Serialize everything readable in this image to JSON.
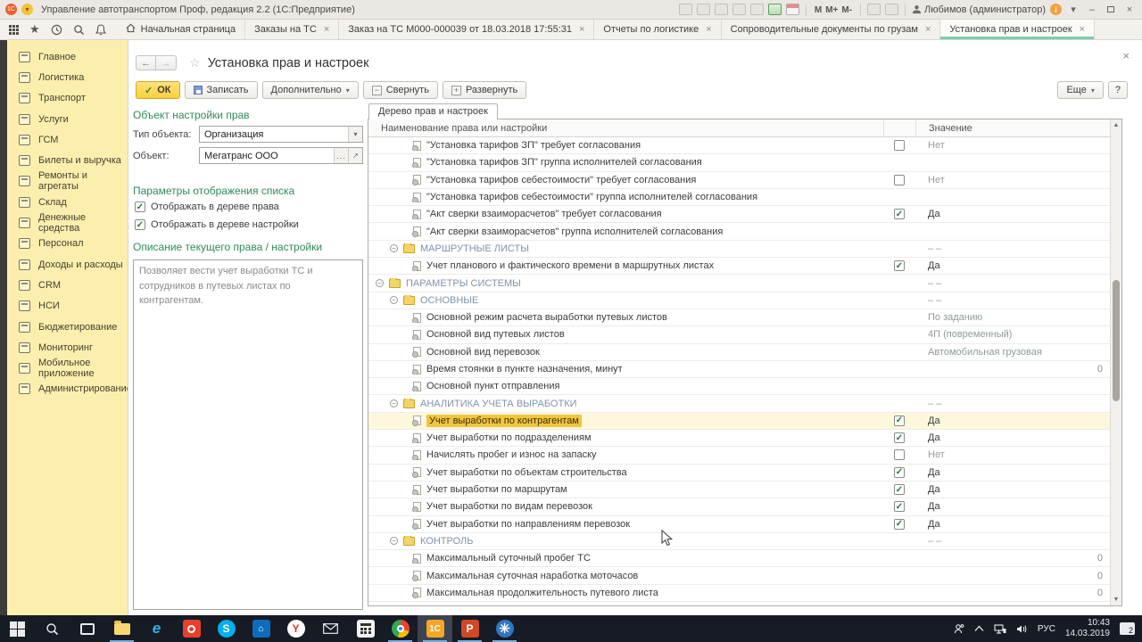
{
  "titlebar": {
    "title": "Управление автотранспортом Проф, редакция 2.2 (1С:Предприятие)",
    "user": "Любимов (администратор)",
    "memory_buttons": [
      "M",
      "M+",
      "M-"
    ],
    "info_glyph": "i",
    "minimize": "–",
    "close": "×"
  },
  "tabs": {
    "items": [
      {
        "label": "Начальная страница",
        "closable": false,
        "active": false,
        "icon": "home-icon"
      },
      {
        "label": "Заказы на ТС",
        "closable": true,
        "active": false
      },
      {
        "label": "Заказ на ТС М000-000039 от 18.03.2018 17:55:31",
        "closable": true,
        "active": false
      },
      {
        "label": "Отчеты по логистике",
        "closable": true,
        "active": false
      },
      {
        "label": "Сопроводительные документы по грузам",
        "closable": true,
        "active": false
      },
      {
        "label": "Установка прав и настроек",
        "closable": true,
        "active": true
      }
    ],
    "close_glyph": "×"
  },
  "sidebar": {
    "items": [
      {
        "label": "Главное",
        "icon": "main-icon"
      },
      {
        "label": "Логистика",
        "icon": "logistics-icon"
      },
      {
        "label": "Транспорт",
        "icon": "transport-icon"
      },
      {
        "label": "Услуги",
        "icon": "services-icon"
      },
      {
        "label": "ГСМ",
        "icon": "fuel-icon"
      },
      {
        "label": "Билеты и выручка",
        "icon": "tickets-icon"
      },
      {
        "label": "Ремонты и агрегаты",
        "icon": "repairs-icon"
      },
      {
        "label": "Склад",
        "icon": "warehouse-icon"
      },
      {
        "label": "Денежные средства",
        "icon": "money-icon"
      },
      {
        "label": "Персонал",
        "icon": "personnel-icon"
      },
      {
        "label": "Доходы и расходы",
        "icon": "income-icon"
      },
      {
        "label": "CRM",
        "icon": "crm-icon"
      },
      {
        "label": "НСИ",
        "icon": "nsi-icon"
      },
      {
        "label": "Бюджетирование",
        "icon": "budget-icon"
      },
      {
        "label": "Мониторинг",
        "icon": "monitoring-icon"
      },
      {
        "label": "Мобильное приложение",
        "icon": "mobile-icon"
      },
      {
        "label": "Администрирование",
        "icon": "admin-icon"
      }
    ]
  },
  "page": {
    "title": "Установка прав и настроек",
    "back": "←",
    "forward": "→",
    "star": "☆",
    "close": "×",
    "toolbar": {
      "ok": "ОК",
      "save": "Записать",
      "more_menu": "Дополнительно",
      "collapse": "Свернуть",
      "expand": "Развернуть",
      "more": "Еще",
      "help": "?",
      "arrow": "▾"
    },
    "form": {
      "section_object": "Объект настройки прав",
      "type_label": "Тип объекта:",
      "type_value": "Организация",
      "object_label": "Объект:",
      "object_value": "Мегатранс ООО",
      "object_dots": "...",
      "object_open": "↗",
      "section_display": "Параметры отображения списка",
      "check_rights_label": "Отображать в дереве права",
      "check_rights_checked": true,
      "check_settings_label": "Отображать в дереве настройки",
      "check_settings_checked": true,
      "section_description": "Описание текущего права / настройки",
      "description": "Позволяет вести учет выработки ТС и сотрудников в путевых листах по контрагентам."
    },
    "tree": {
      "tab": "Дерево прав и настроек",
      "col_name": "Наименование права или настройки",
      "col_value": "Значение",
      "rows": [
        {
          "type": "item",
          "label": "\"Установка тарифов ЗП\" требует согласования",
          "check": "unchecked",
          "value": "Нет",
          "selected": false
        },
        {
          "type": "item",
          "label": "\"Установка тарифов ЗП\" группа исполнителей согласования",
          "check": "none",
          "value": "",
          "selected": false
        },
        {
          "type": "item",
          "label": "\"Установка тарифов себестоимости\" требует согласования",
          "check": "unchecked",
          "value": "Нет",
          "selected": false
        },
        {
          "type": "item",
          "label": "\"Установка тарифов себестоимости\" группа исполнителей согласования",
          "check": "none",
          "value": "",
          "selected": false
        },
        {
          "type": "item",
          "label": "\"Акт сверки взаиморасчетов\" требует согласования",
          "check": "checked",
          "value": "Да",
          "selected": false
        },
        {
          "type": "item",
          "label": "\"Акт сверки взаиморасчетов\" группа исполнителей согласования",
          "check": "none",
          "value": "",
          "selected": false
        },
        {
          "type": "group",
          "level": 2,
          "label": "МАРШРУТНЫЕ ЛИСТЫ",
          "check": "none",
          "value": "–  –",
          "selected": false
        },
        {
          "type": "item",
          "label": "Учет планового и фактического времени в маршрутных листах",
          "check": "checked",
          "value": "Да",
          "selected": false
        },
        {
          "type": "group",
          "level": 1,
          "label": "ПАРАМЕТРЫ СИСТЕМЫ",
          "check": "none",
          "value": "–  –",
          "selected": false
        },
        {
          "type": "group",
          "level": 2,
          "label": "ОСНОВНЫЕ",
          "check": "none",
          "value": "–  –",
          "selected": false
        },
        {
          "type": "item",
          "label": "Основной режим расчета выработки путевых листов",
          "check": "none",
          "value": "По заданию",
          "selected": false
        },
        {
          "type": "item",
          "label": "Основной вид путевых листов",
          "check": "none",
          "value": "4П (повременный)",
          "selected": false
        },
        {
          "type": "item",
          "label": "Основной вид перевозок",
          "check": "none",
          "value": "Автомобильная грузовая",
          "selected": false
        },
        {
          "type": "item",
          "label": "Время стоянки в пункте назначения, минут",
          "check": "none",
          "value": "0",
          "align": "right",
          "selected": false
        },
        {
          "type": "item",
          "label": "Основной пункт отправления",
          "check": "none",
          "value": "",
          "selected": false
        },
        {
          "type": "group",
          "level": 2,
          "label": "АНАЛИТИКА УЧЕТА ВЫРАБОТКИ",
          "check": "none",
          "value": "–  –",
          "selected": false
        },
        {
          "type": "item",
          "label": "Учет выработки по контрагентам",
          "check": "checked",
          "value": "Да",
          "selected": true
        },
        {
          "type": "item",
          "label": "Учет выработки по подразделениям",
          "check": "checked",
          "value": "Да",
          "selected": false
        },
        {
          "type": "item",
          "label": "Начислять пробег и износ на запаску",
          "check": "unchecked",
          "value": "Нет",
          "selected": false
        },
        {
          "type": "item",
          "label": "Учет выработки по объектам строительства",
          "check": "checked",
          "value": "Да",
          "selected": false
        },
        {
          "type": "item",
          "label": "Учет выработки по маршрутам",
          "check": "checked",
          "value": "Да",
          "selected": false
        },
        {
          "type": "item",
          "label": "Учет выработки по видам перевозок",
          "check": "checked",
          "value": "Да",
          "selected": false
        },
        {
          "type": "item",
          "label": "Учет выработки по направлениям перевозок",
          "check": "checked",
          "value": "Да",
          "selected": false
        },
        {
          "type": "group",
          "level": 2,
          "label": "КОНТРОЛЬ",
          "check": "none",
          "value": "–  –",
          "selected": false
        },
        {
          "type": "item",
          "label": "Максимальный суточный пробег ТС",
          "check": "none",
          "value": "0",
          "align": "right",
          "selected": false
        },
        {
          "type": "item",
          "label": "Максимальная суточная наработка моточасов",
          "check": "none",
          "value": "0",
          "align": "right",
          "selected": false
        },
        {
          "type": "item",
          "label": "Максимальная продолжительность путевого листа",
          "check": "none",
          "value": "0",
          "align": "right",
          "selected": false
        }
      ]
    }
  },
  "taskbar": {
    "icons": [
      {
        "name": "start-button",
        "open": false,
        "active": false
      },
      {
        "name": "search-button",
        "open": false,
        "active": false
      },
      {
        "name": "task-view-button",
        "open": false,
        "active": false
      },
      {
        "name": "file-explorer-icon",
        "open": true,
        "active": false
      },
      {
        "name": "edge-icon",
        "open": false,
        "active": false
      },
      {
        "name": "red-circle-app-icon",
        "open": false,
        "active": false
      },
      {
        "name": "skype-icon",
        "open": false,
        "active": false
      },
      {
        "name": "store-icon",
        "open": false,
        "active": false
      },
      {
        "name": "yandex-browser-icon",
        "open": false,
        "active": false
      },
      {
        "name": "mail-icon",
        "open": false,
        "active": false
      },
      {
        "name": "calculator-icon",
        "open": false,
        "active": false
      },
      {
        "name": "chrome-icon",
        "open": true,
        "active": false
      },
      {
        "name": "1c-icon",
        "open": true,
        "active": true,
        "label": "1С"
      },
      {
        "name": "powerpoint-icon",
        "open": true,
        "active": false,
        "label": "P"
      },
      {
        "name": "snowflake-app-icon",
        "open": true,
        "active": false
      }
    ],
    "tray": {
      "lang": "РУС",
      "time": "10:43",
      "date": "14.03.2019",
      "badge": "2"
    }
  },
  "colors": {
    "accent_yellow": "#fccf3e",
    "sidebar_bg": "#fcefae",
    "heading_green": "#2e8b57",
    "selection_gold": "#f1c63f",
    "selected_row_bg": "#fdf8dc",
    "group_text": "#8093ab",
    "tab_underline": "#7ecbb4",
    "taskbar_bg": "#171b24"
  }
}
